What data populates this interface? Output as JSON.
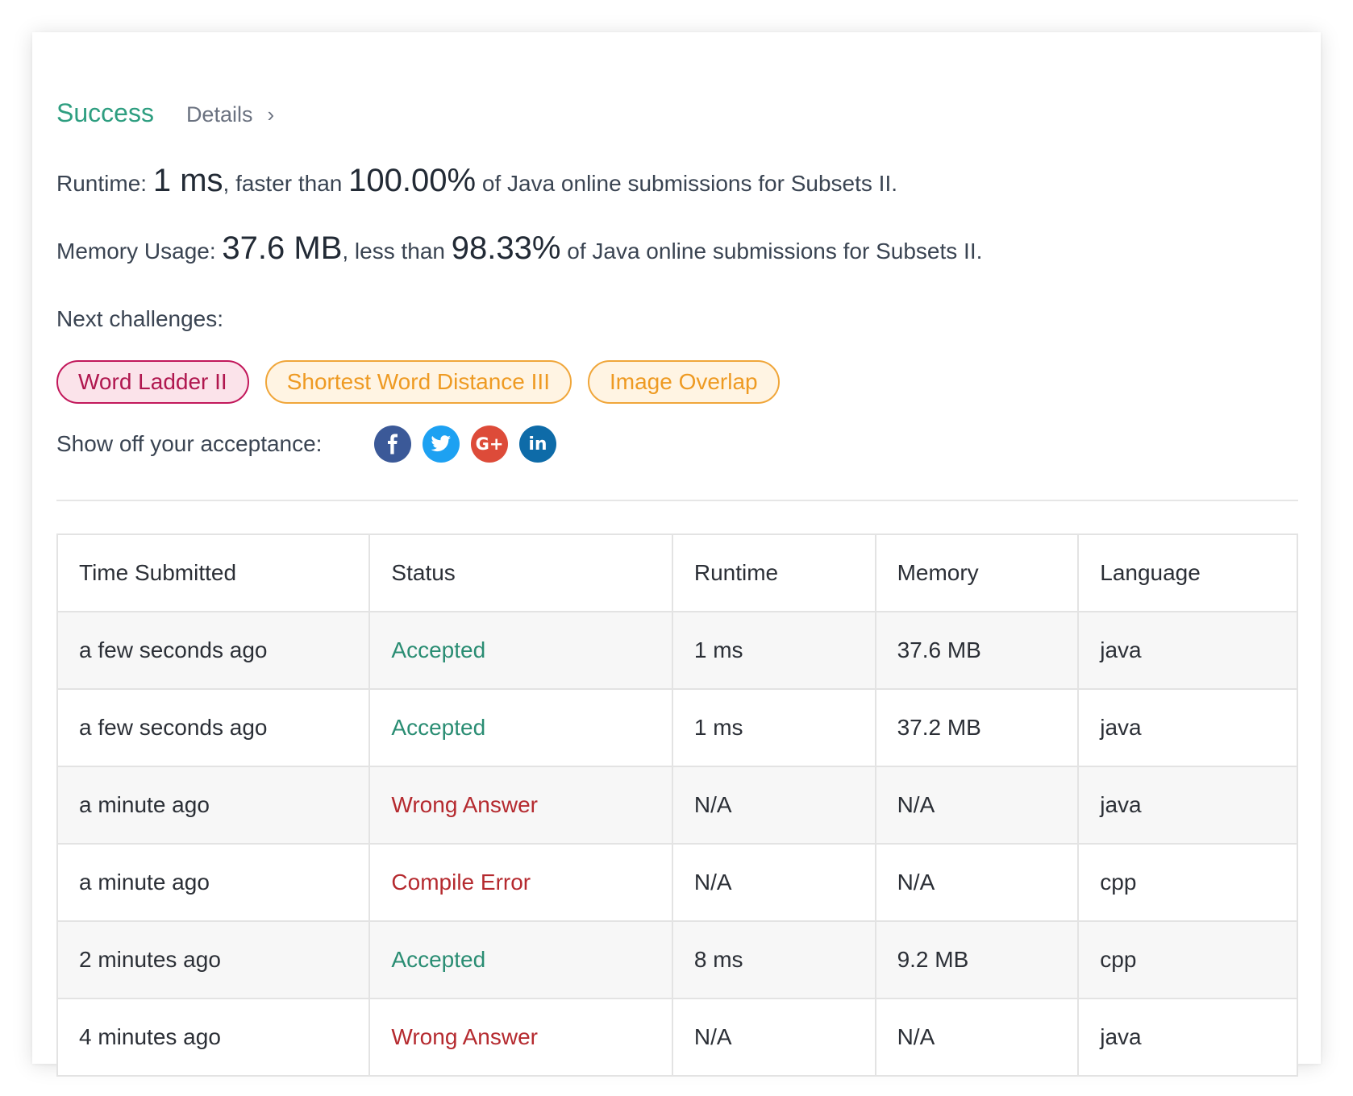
{
  "header": {
    "status": "Success",
    "details_label": "Details",
    "details_chevron": "›"
  },
  "runtime": {
    "label": "Runtime:",
    "value": "1 ms",
    "comparator": ", faster than",
    "percent": "100.00%",
    "suffix": "of Java online submissions for Subsets II."
  },
  "memory": {
    "label": "Memory Usage:",
    "value": "37.6 MB",
    "comparator": ", less than",
    "percent": "98.33%",
    "suffix": "of Java online submissions for Subsets II."
  },
  "next_challenges": {
    "label": "Next challenges:",
    "items": [
      {
        "label": "Word Ladder II",
        "difficulty": "hard"
      },
      {
        "label": "Shortest Word Distance III",
        "difficulty": "medium"
      },
      {
        "label": "Image Overlap",
        "difficulty": "medium"
      }
    ]
  },
  "share": {
    "label": "Show off your acceptance:",
    "icons": [
      "facebook-icon",
      "twitter-icon",
      "google-plus-icon",
      "linkedin-icon"
    ],
    "gplus_text": "G+",
    "linkedin_text": "in"
  },
  "table": {
    "columns": [
      "Time Submitted",
      "Status",
      "Runtime",
      "Memory",
      "Language"
    ],
    "rows": [
      {
        "time": "a few seconds ago",
        "status": "Accepted",
        "runtime": "1 ms",
        "memory": "37.6 MB",
        "language": "java"
      },
      {
        "time": "a few seconds ago",
        "status": "Accepted",
        "runtime": "1 ms",
        "memory": "37.2 MB",
        "language": "java"
      },
      {
        "time": "a minute ago",
        "status": "Wrong Answer",
        "runtime": "N/A",
        "memory": "N/A",
        "language": "java"
      },
      {
        "time": "a minute ago",
        "status": "Compile Error",
        "runtime": "N/A",
        "memory": "N/A",
        "language": "cpp"
      },
      {
        "time": "2 minutes ago",
        "status": "Accepted",
        "runtime": "8 ms",
        "memory": "9.2 MB",
        "language": "cpp"
      },
      {
        "time": "4 minutes ago",
        "status": "Wrong Answer",
        "runtime": "N/A",
        "memory": "N/A",
        "language": "java"
      }
    ]
  },
  "colors": {
    "success": "#2e9e80",
    "accepted": "#2a8d73",
    "error": "#b52a2f",
    "hard": "#c2185b",
    "medium": "#f0a63a"
  }
}
